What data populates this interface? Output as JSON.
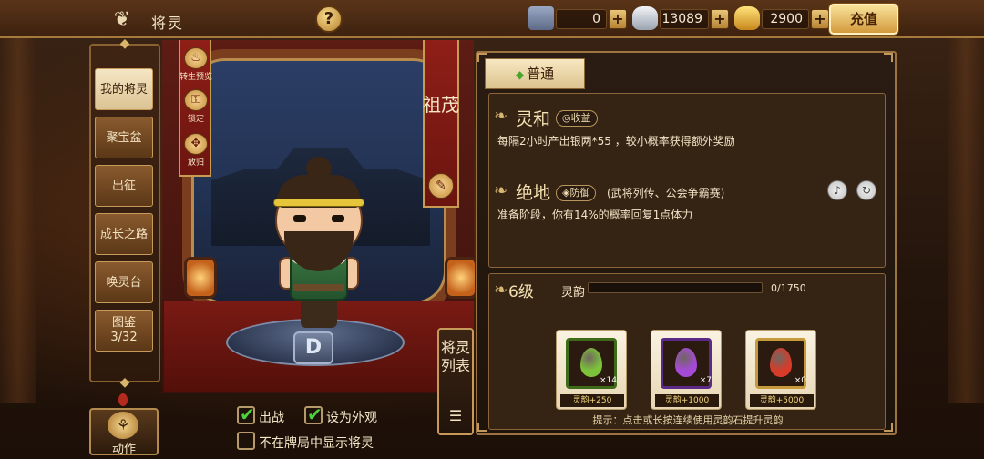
{
  "header": {
    "title": "将灵",
    "help_label": "?",
    "currencies": [
      {
        "name": "token-icon",
        "value": "0"
      },
      {
        "name": "silver-ingot-icon",
        "value": "13089"
      },
      {
        "name": "gold-ingot-icon",
        "value": "2900"
      }
    ],
    "plus_label": "+",
    "recharge_label": "充值"
  },
  "sidebar": {
    "items": [
      {
        "label": "我的将灵",
        "active": true
      },
      {
        "label": "聚宝盆"
      },
      {
        "label": "出征"
      },
      {
        "label": "成长之路"
      },
      {
        "label": "唤灵台"
      },
      {
        "label": "图鉴",
        "sub": "3/32"
      }
    ]
  },
  "banner": {
    "rebirth_label": "转生预览",
    "lock_label": "锁定",
    "release_label": "放归",
    "character_name": "祖茂",
    "pedestal_badge": "D"
  },
  "list_button": {
    "label": "将灵列表"
  },
  "bottom": {
    "action_label": "动作",
    "deploy_label": "出战",
    "deploy_checked": true,
    "appearance_label": "设为外观",
    "appearance_checked": true,
    "hide_in_match_label": "不在牌局中显示将灵",
    "hide_in_match_checked": false
  },
  "panel": {
    "tab_label": "普通",
    "skills": [
      {
        "name": "灵和",
        "tag": "收益",
        "desc": "每隔2小时产出银两*55 ，较小概率获得额外奖励"
      },
      {
        "name": "绝地",
        "tag": "防御",
        "scope": "(武将列传、公会争霸赛)",
        "desc": "准备阶段，你有14%的概率回复1点体力"
      }
    ],
    "level": {
      "level_text": "6级",
      "resonance_label": "灵韵",
      "current": 0,
      "max": 1750,
      "exp_text": "0/1750"
    },
    "items": [
      {
        "name": "green-egg",
        "count": "×14",
        "label": "灵韵+250",
        "color": "#7cc23a",
        "border": "#3f6a1a"
      },
      {
        "name": "purple-egg",
        "count": "×7",
        "label": "灵韵+1000",
        "color": "#a54ad6",
        "border": "#5a2a86"
      },
      {
        "name": "red-cross-egg",
        "count": "×0",
        "label": "灵韵+5000",
        "color": "#d73b2a",
        "border": "#c49a3a"
      }
    ],
    "hint": "提示：点击或长按连续使用灵韵石提升灵韵"
  }
}
